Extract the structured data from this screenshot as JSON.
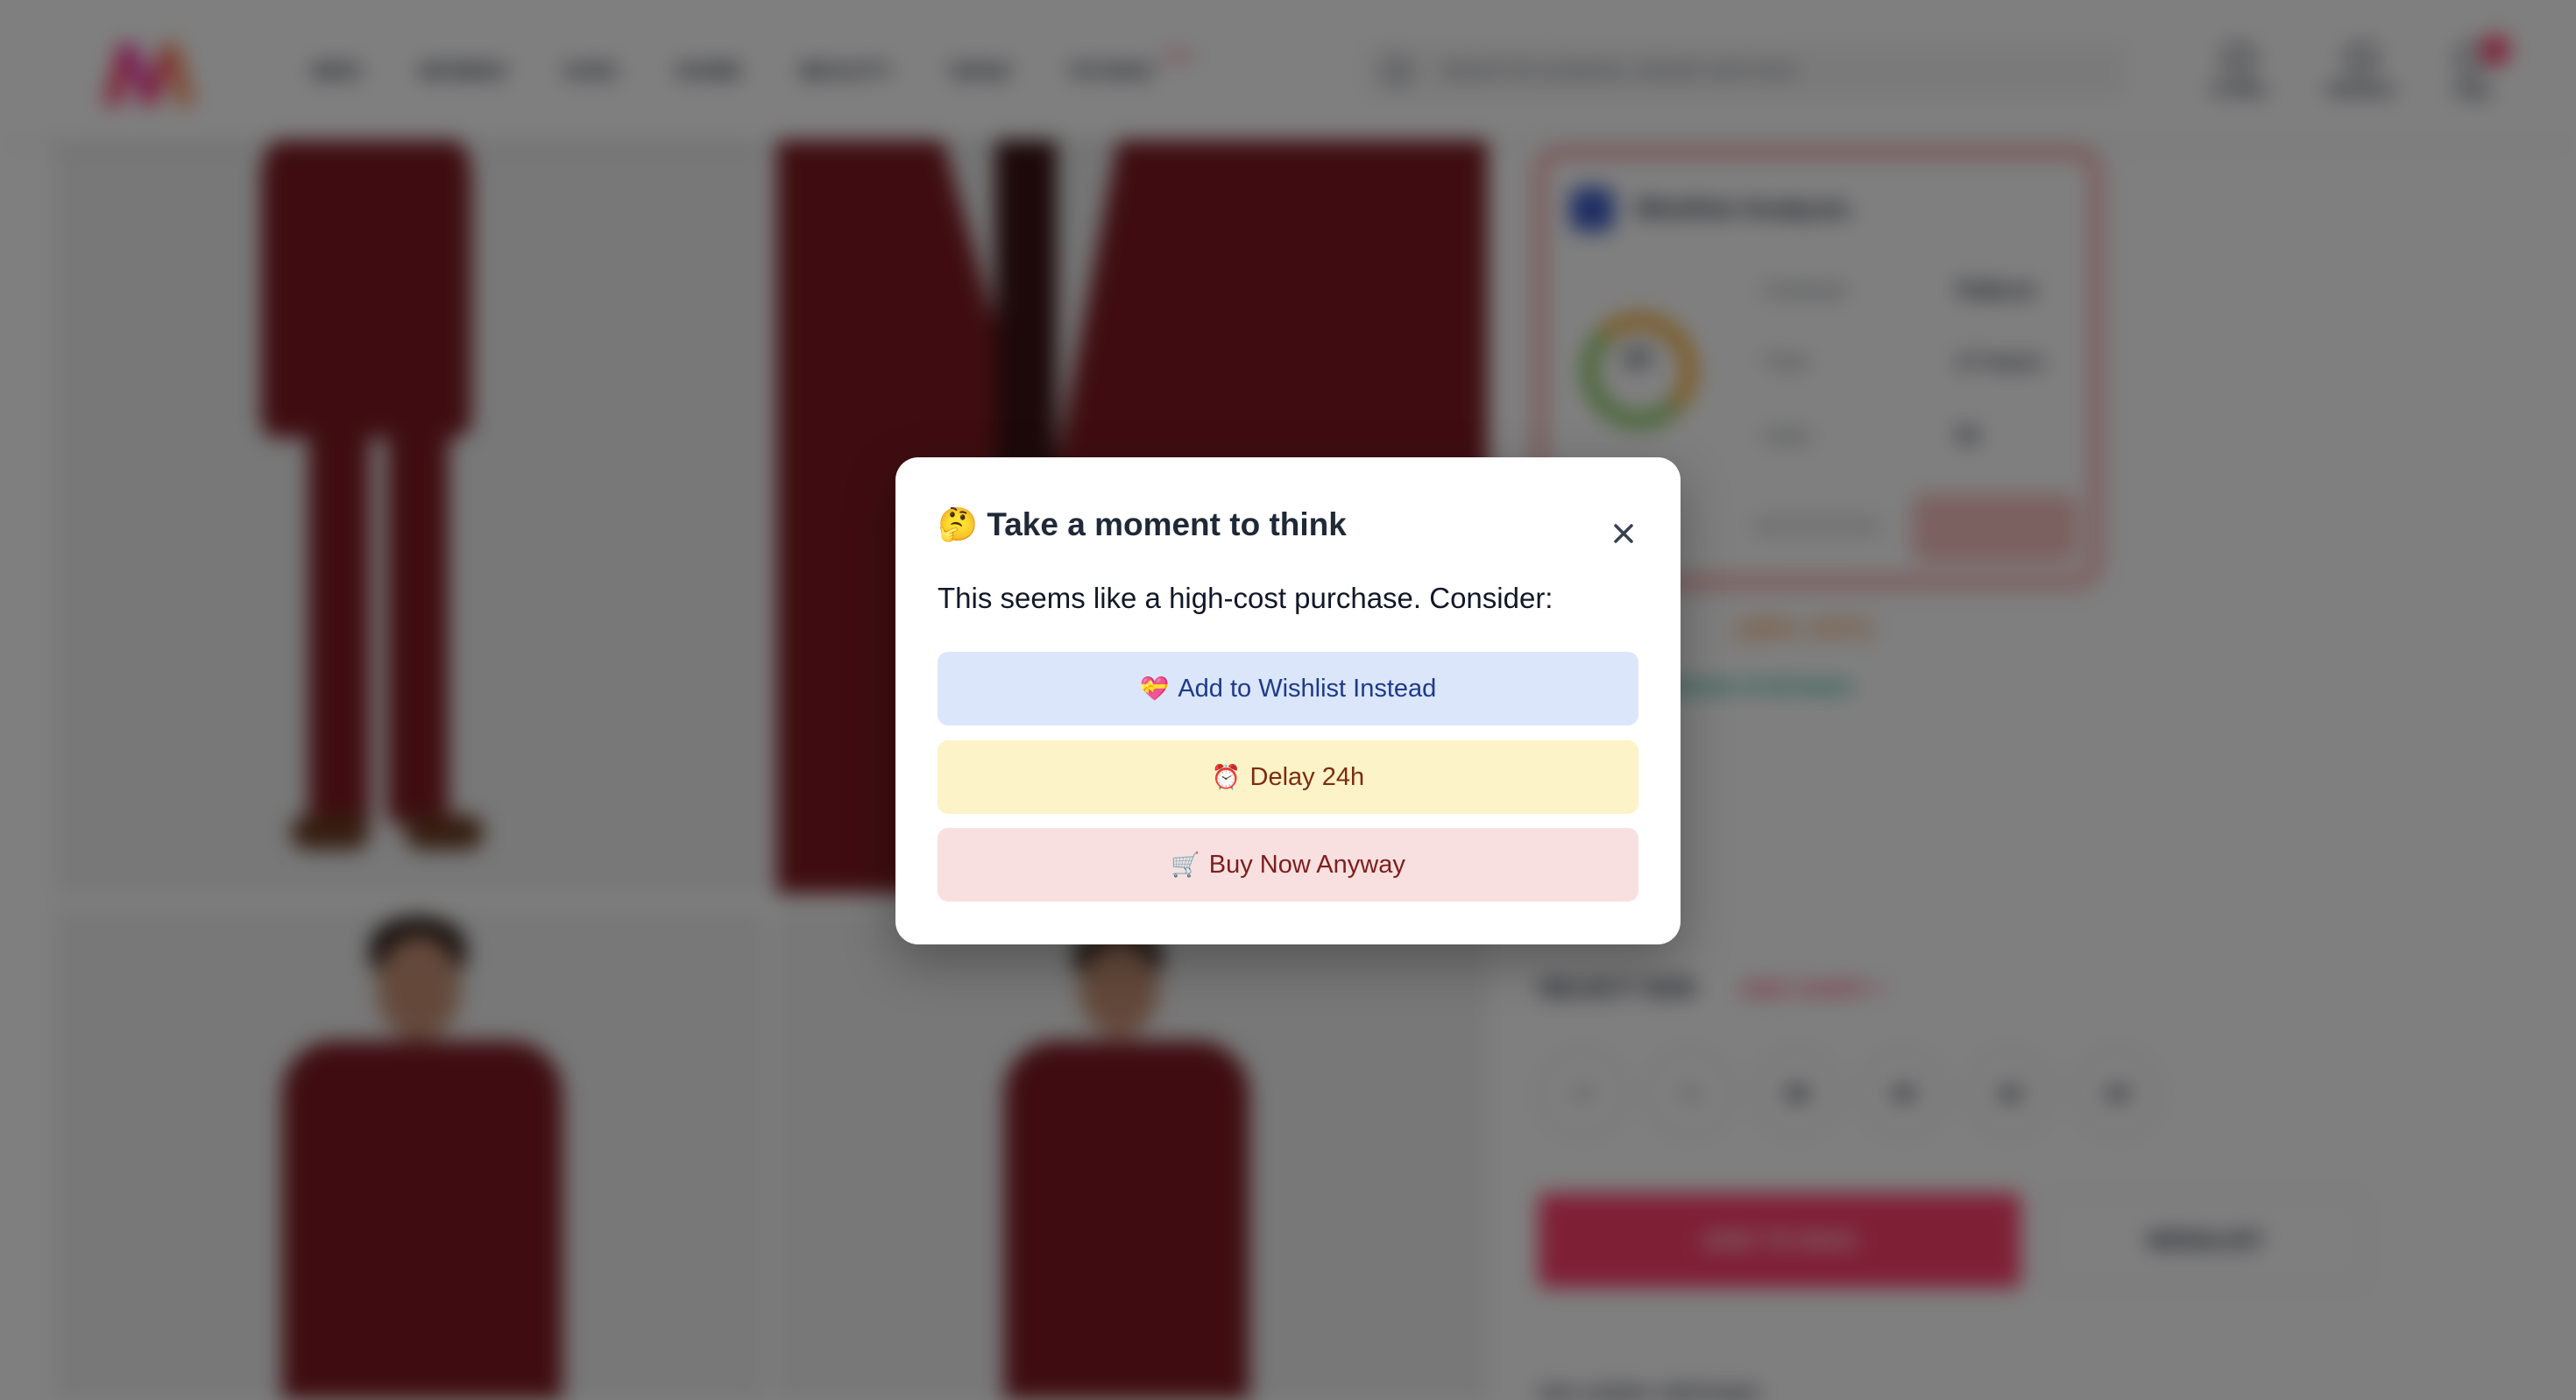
{
  "header": {
    "nav": [
      "MEN",
      "WOMEN",
      "KIDS",
      "HOME",
      "BEAUTY",
      "GENZ",
      "STUDIO"
    ],
    "studio_badge": "NEW",
    "search_placeholder": "Search for products, brands and more",
    "actions": [
      "Profile",
      "Wishlist",
      "Bag"
    ]
  },
  "wishlist_analysis": {
    "title": "Wishlist Analysis",
    "score": "22",
    "rows": [
      {
        "label": "Cost/use",
        "value": "₹368.24"
      },
      {
        "label": "Time",
        "value": "17 hours"
      },
      {
        "label": "Uses",
        "value": "50"
      }
    ]
  },
  "product": {
    "discount": "(38% OFF)",
    "tax_note": "inclusive of all taxes",
    "size_title": "SELECT SIZE",
    "size_chart": "SIZE CHART >",
    "sizes": [
      "36",
      "38",
      "38",
      "40",
      "42",
      "44"
    ],
    "add_to_bag": "ADD TO BAG",
    "wishlist": "WISHLIST",
    "delivery": "DELIVERY OPTIONS"
  },
  "modal": {
    "title_emoji": "🤔",
    "title": "Take a moment to think",
    "message": "This seems like a high-cost purchase. Consider:",
    "close_symbol": "×",
    "buttons": [
      {
        "emoji": "💝",
        "label": "Add to Wishlist Instead"
      },
      {
        "emoji": "⏰",
        "label": "Delay 24h"
      },
      {
        "emoji": "🛒",
        "label": "Buy Now Anyway"
      }
    ],
    "colors": {
      "wishlist_bg": "#dbe6fa",
      "delay_bg": "#fdf3c8",
      "buy_bg": "#f9e0e0"
    }
  }
}
